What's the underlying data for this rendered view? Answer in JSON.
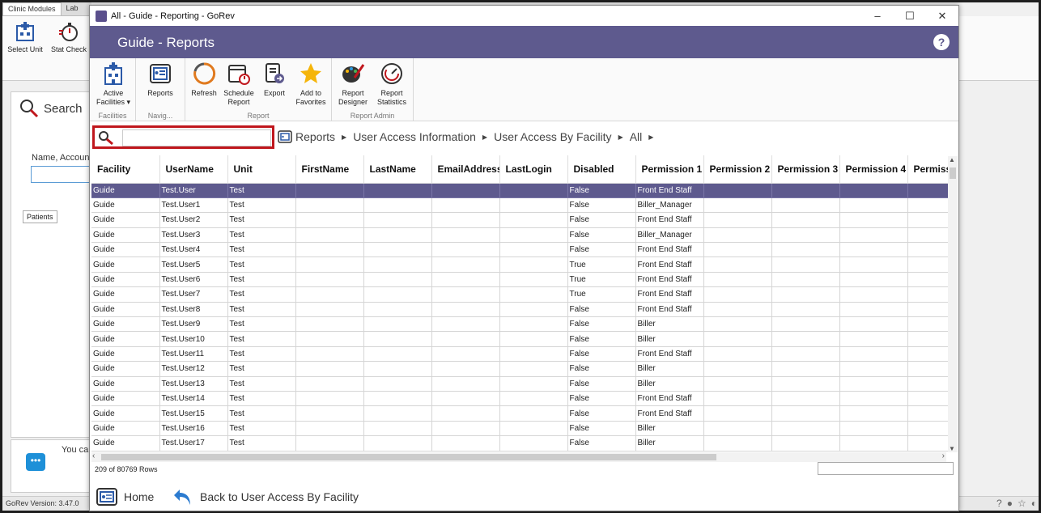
{
  "background": {
    "tabs": [
      "Clinic Modules",
      "Lab"
    ],
    "ribbon_buttons": [
      "Select Unit",
      "Stat Check"
    ],
    "search_title": "Search",
    "search_label": "Name, Accoun",
    "patients_tab": "Patients",
    "chat_text": "You ca",
    "version": "GoRev Version: 3.47.0"
  },
  "window": {
    "title": "All - Guide - Reporting - GoRev",
    "minimize": "–",
    "maximize": "☐",
    "close": "✕",
    "header_title": "Guide - Reports",
    "help": "?"
  },
  "ribbon": {
    "groups": [
      {
        "label": "Facilities",
        "buttons": [
          {
            "label": "Active Facilities ▾",
            "icon": "building-icon"
          }
        ]
      },
      {
        "label": "Navig...",
        "buttons": [
          {
            "label": "Reports",
            "icon": "reports-icon"
          }
        ]
      },
      {
        "label": "Report",
        "buttons": [
          {
            "label": "Refresh",
            "icon": "refresh-icon"
          },
          {
            "label": "Schedule Report",
            "icon": "calendar-icon"
          },
          {
            "label": "Export",
            "icon": "export-icon"
          },
          {
            "label": "Add to Favorites",
            "icon": "star-icon"
          }
        ]
      },
      {
        "label": "Report Admin",
        "buttons": [
          {
            "label": "Report Designer",
            "icon": "palette-icon"
          },
          {
            "label": "Report Statistics",
            "icon": "gauge-icon"
          }
        ]
      }
    ]
  },
  "search": {
    "placeholder": "",
    "value": ""
  },
  "breadcrumb": [
    "Reports",
    "User Access Information",
    "User Access By Facility",
    "All"
  ],
  "grid": {
    "columns": [
      "Facility",
      "UserName",
      "Unit",
      "FirstName",
      "LastName",
      "EmailAddress",
      "LastLogin",
      "Disabled",
      "Permission 1",
      "Permission 2",
      "Permission 3",
      "Permission 4",
      "Permissi"
    ],
    "rows": [
      [
        "Guide",
        "Test.User",
        "Test",
        "",
        "",
        "",
        "",
        "False",
        "Front End Staff",
        "",
        "",
        "",
        ""
      ],
      [
        "Guide",
        "Test.User1",
        "Test",
        "",
        "",
        "",
        "",
        "False",
        "Biller_Manager",
        "",
        "",
        "",
        ""
      ],
      [
        "Guide",
        "Test.User2",
        "Test",
        "",
        "",
        "",
        "",
        "False",
        "Front End Staff",
        "",
        "",
        "",
        ""
      ],
      [
        "Guide",
        "Test.User3",
        "Test",
        "",
        "",
        "",
        "",
        "False",
        "Biller_Manager",
        "",
        "",
        "",
        ""
      ],
      [
        "Guide",
        "Test.User4",
        "Test",
        "",
        "",
        "",
        "",
        "False",
        "Front End Staff",
        "",
        "",
        "",
        ""
      ],
      [
        "Guide",
        "Test.User5",
        "Test",
        "",
        "",
        "",
        "",
        "True",
        "Front End Staff",
        "",
        "",
        "",
        ""
      ],
      [
        "Guide",
        "Test.User6",
        "Test",
        "",
        "",
        "",
        "",
        "True",
        "Front End Staff",
        "",
        "",
        "",
        ""
      ],
      [
        "Guide",
        "Test.User7",
        "Test",
        "",
        "",
        "",
        "",
        "True",
        "Front End Staff",
        "",
        "",
        "",
        ""
      ],
      [
        "Guide",
        "Test.User8",
        "Test",
        "",
        "",
        "",
        "",
        "False",
        "Front End Staff",
        "",
        "",
        "",
        ""
      ],
      [
        "Guide",
        "Test.User9",
        "Test",
        "",
        "",
        "",
        "",
        "False",
        "Biller",
        "",
        "",
        "",
        ""
      ],
      [
        "Guide",
        "Test.User10",
        "Test",
        "",
        "",
        "",
        "",
        "False",
        "Biller",
        "",
        "",
        "",
        ""
      ],
      [
        "Guide",
        "Test.User11",
        "Test",
        "",
        "",
        "",
        "",
        "False",
        "Front End Staff",
        "",
        "",
        "",
        ""
      ],
      [
        "Guide",
        "Test.User12",
        "Test",
        "",
        "",
        "",
        "",
        "False",
        "Biller",
        "",
        "",
        "",
        ""
      ],
      [
        "Guide",
        "Test.User13",
        "Test",
        "",
        "",
        "",
        "",
        "False",
        "Biller",
        "",
        "",
        "",
        ""
      ],
      [
        "Guide",
        "Test.User14",
        "Test",
        "",
        "",
        "",
        "",
        "False",
        "Front End Staff",
        "",
        "",
        "",
        ""
      ],
      [
        "Guide",
        "Test.User15",
        "Test",
        "",
        "",
        "",
        "",
        "False",
        "Front End Staff",
        "",
        "",
        "",
        ""
      ],
      [
        "Guide",
        "Test.User16",
        "Test",
        "",
        "",
        "",
        "",
        "False",
        "Biller",
        "",
        "",
        "",
        ""
      ],
      [
        "Guide",
        "Test.User17",
        "Test",
        "",
        "",
        "",
        "",
        "False",
        "Biller",
        "",
        "",
        "",
        ""
      ]
    ],
    "selected_row": 0,
    "row_count": "209 of 80769 Rows"
  },
  "footer": {
    "home": "Home",
    "back": "Back to User Access By Facility"
  },
  "colors": {
    "accent": "#5e5a8e",
    "highlight_border": "#c0171d"
  }
}
